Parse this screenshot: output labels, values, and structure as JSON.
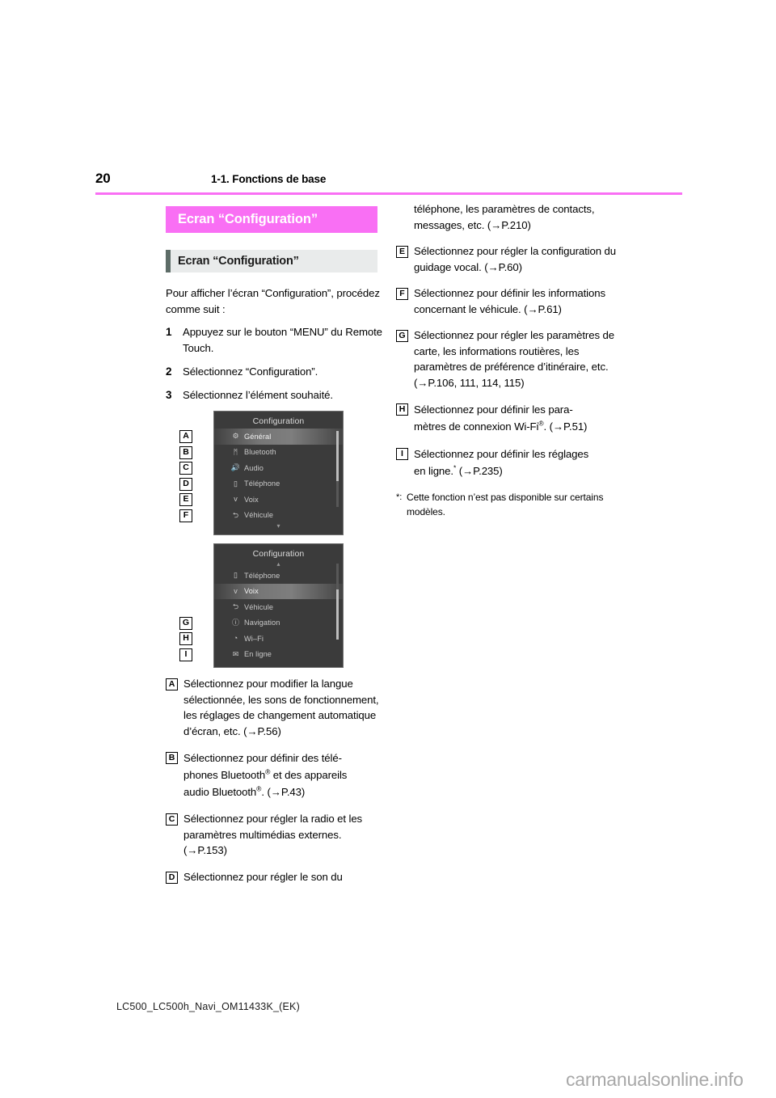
{
  "header": {
    "page_number": "20",
    "title": "1-1. Fonctions de base",
    "rule_color": "#f96ff4"
  },
  "banner": {
    "label": "Ecran “Configuration”",
    "bg_color": "#f96ff4",
    "text_color": "#ffffff"
  },
  "subheading": {
    "label": "Ecran “Configuration”",
    "bg_color": "#e9ebeb",
    "accent_color": "#5d6c67"
  },
  "intro": {
    "paragraph": "Pour afficher l’écran “Configuration”, procédez comme suit :",
    "steps": [
      {
        "num": "1",
        "text": "Appuyez sur le bouton “MENU” du Remote Touch."
      },
      {
        "num": "2",
        "text": "Sélectionnez “Configuration”."
      },
      {
        "num": "3",
        "text": "Sélectionnez l’élément souhaité."
      }
    ]
  },
  "screens": [
    {
      "title": "Configuration",
      "rows": [
        {
          "tag": "A",
          "icon": "gear-icon",
          "glyph": "⚙",
          "label": "Général",
          "selected": true
        },
        {
          "tag": "B",
          "icon": "bluetooth-icon",
          "glyph": "ᛗ",
          "label": "Bluetooth",
          "selected": false
        },
        {
          "tag": "C",
          "icon": "speaker-icon",
          "glyph": "🔊",
          "label": "Audio",
          "selected": false
        },
        {
          "tag": "D",
          "icon": "phone-icon",
          "glyph": "▯",
          "label": "Téléphone",
          "selected": false
        },
        {
          "tag": "E",
          "icon": "voice-icon",
          "glyph": "ᴠ",
          "label": "Voix",
          "selected": false
        },
        {
          "tag": "F",
          "icon": "vehicle-icon",
          "glyph": "⮌",
          "label": "Véhicule",
          "selected": false
        }
      ],
      "scroll_up": false,
      "scroll_down": true
    },
    {
      "title": "Configuration",
      "rows": [
        {
          "tag": "",
          "icon": "phone-icon",
          "glyph": "▯",
          "label": "Téléphone",
          "selected": false
        },
        {
          "tag": "",
          "icon": "voice-icon",
          "glyph": "ᴠ",
          "label": "Voix",
          "selected": true
        },
        {
          "tag": "",
          "icon": "vehicle-icon",
          "glyph": "⮌",
          "label": "Véhicule",
          "selected": false
        },
        {
          "tag": "G",
          "icon": "navigation-icon",
          "glyph": "ⓘ",
          "label": "Navigation",
          "selected": false
        },
        {
          "tag": "H",
          "icon": "wifi-icon",
          "glyph": "◔",
          "label": "Wi–Fi",
          "selected": false
        },
        {
          "tag": "I",
          "icon": "online-icon",
          "glyph": "✉",
          "label": "En ligne",
          "selected": false
        }
      ],
      "scroll_up": true,
      "scroll_down": false
    }
  ],
  "callouts_left": [
    {
      "tag": "A",
      "text": "Sélectionnez pour modifier la langue sélectionnée, les sons de fonctionnement, les réglages de changement automatique d’écran, etc. (→P.56)"
    },
    {
      "tag": "C",
      "text": "Sélectionnez pour régler la radio et les paramètres multimédias externes. (→P.153)"
    },
    {
      "tag": "D",
      "text": "Sélectionnez pour régler le son du"
    }
  ],
  "callout_b": {
    "tag": "B",
    "line1": "Sélectionnez pour définir des télé-",
    "line2_pre": "phones Bluetooth",
    "line2_post": " et des appareils",
    "line3_pre": "audio Bluetooth",
    "line3_post": ". (→P.43)",
    "registered": "®"
  },
  "callouts_right": [
    {
      "tag": "",
      "text": "téléphone, les paramètres de contacts, messages, etc. (→P.210)"
    },
    {
      "tag": "E",
      "text": "Sélectionnez pour régler la configuration du guidage vocal. (→P.60)"
    },
    {
      "tag": "F",
      "text": "Sélectionnez pour définir les informations concernant le véhicule. (→P.61)"
    },
    {
      "tag": "G",
      "text": "Sélectionnez pour régler les paramètres de carte, les informations routières, les paramètres de préférence d’itinéraire, etc. (→P.106, 111, 114, 115)"
    }
  ],
  "callout_h": {
    "tag": "H",
    "line1": "Sélectionnez pour définir les para-",
    "line2_pre": "mètres de connexion Wi-Fi",
    "line2_post": ". (→P.51)",
    "registered": "®"
  },
  "callout_i": {
    "tag": "I",
    "line1": "Sélectionnez pour définir les réglages",
    "line2_pre": "en ligne.",
    "line2_post": " (→P.235)",
    "asterisk": "*"
  },
  "footnote": {
    "mark": "*:",
    "text": "Cette fonction n’est pas disponible sur certains modèles."
  },
  "footer": {
    "code": "LC500_LC500h_Navi_OM11433K_(EK)",
    "watermark": "carmanualsonline.info"
  }
}
